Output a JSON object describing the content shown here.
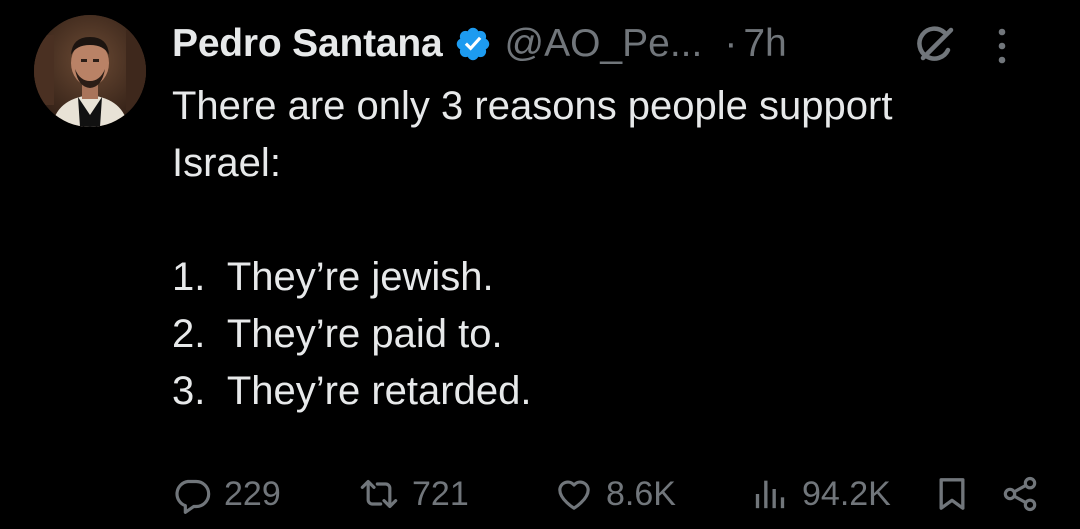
{
  "author": {
    "name": "Pedro Santana",
    "handle": "@AO_Pe...",
    "separator": "·",
    "timestamp": "7h",
    "verified": true
  },
  "tweet": {
    "lines": [
      "There are only 3 reasons people support",
      "Israel:",
      "",
      "1.  They’re jewish.",
      "2.  They’re paid to.",
      "3.  They’re retarded."
    ]
  },
  "metrics": {
    "replies": "229",
    "reposts": "721",
    "likes": "8.6K",
    "views": "94.2K"
  },
  "icons": {
    "verified": "verified-badge-icon",
    "grok": "grok-icon",
    "more": "more-vertical-icon",
    "reply": "reply-icon",
    "repost": "repost-icon",
    "like": "heart-icon",
    "views": "views-icon",
    "bookmark": "bookmark-icon",
    "share": "share-icon"
  },
  "colors": {
    "background": "#000000",
    "text": "#e7e9ea",
    "muted": "#71767b",
    "verified": "#1d9bf0"
  }
}
